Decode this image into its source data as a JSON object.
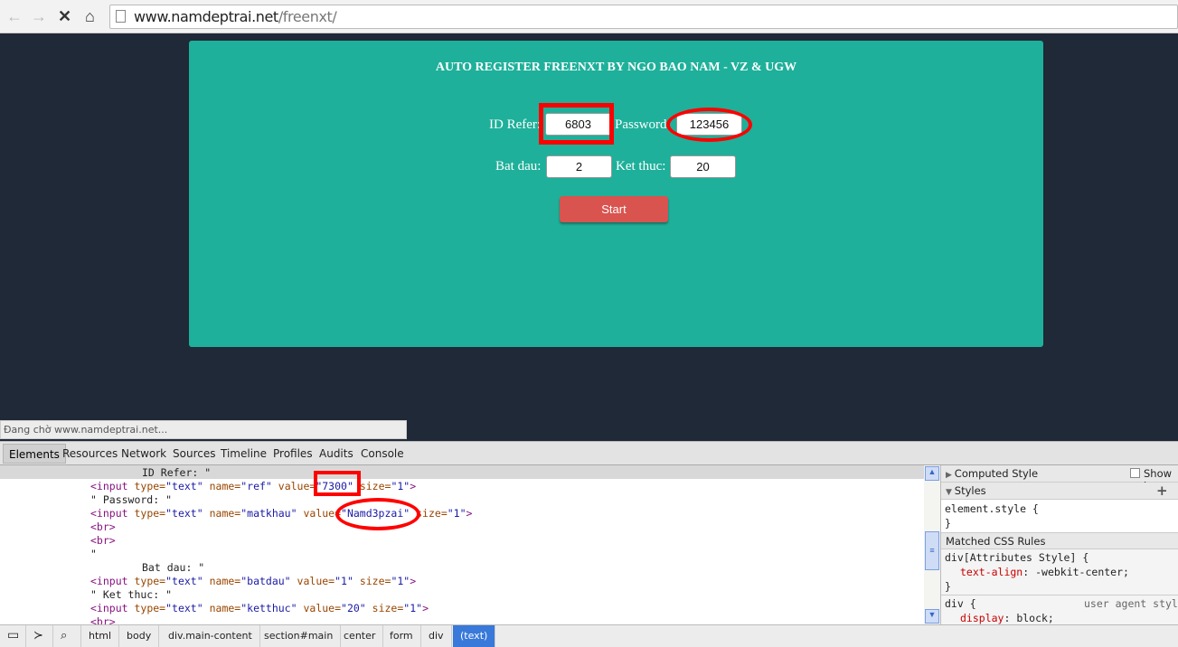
{
  "browser": {
    "url_host": "www.namdeptrai.net",
    "url_path": "/freenxt/",
    "status": "Đang chờ www.namdeptrai.net..."
  },
  "page": {
    "title": "AUTO REGISTER FREENXT BY NGO BAO NAM - VZ & UGW",
    "id_refer_label": "ID Refer:",
    "id_refer_value": "6803",
    "password_label": "Password:",
    "password_value": "123456",
    "bat_dau_label": "Bat dau:",
    "bat_dau_value": "2",
    "ket_thuc_label": "Ket thuc:",
    "ket_thuc_value": "20",
    "start_label": "Start",
    "annotation_color": "#ff0000",
    "panel_color": "#1eb09a"
  },
  "devtools": {
    "tabs": [
      "Elements",
      "Resources",
      "Network",
      "Sources",
      "Timeline",
      "Profiles",
      "Audits",
      "Console"
    ],
    "code": {
      "l0": "ID Refer: \"",
      "input": "<input",
      "type": "type=",
      "text": "\"text\"",
      "name": "name=",
      "value": "value=",
      "size": "size=",
      "one": "\"1\"",
      ">": ">",
      "ref": "\"ref\"",
      "ref_val": "\"7300\"",
      "l2": "\" Password: \"",
      "matkhau": "\"matkhau\"",
      "matkhau_val": "\"Namd3pzai\"",
      "br": "<br>",
      "quote": "\"",
      "l7": "Bat dau: \"",
      "batdau": "\"batdau\"",
      "batdau_val": "\"1\"",
      "l9": "\" Ket thuc: \"",
      "ketthuc": "\"ketthuc\"",
      "ketthuc_val": "\"20\""
    },
    "side": {
      "computed": "Computed Style",
      "show_inherited": "Show in",
      "styles": "Styles",
      "element_style": "element.style {",
      "close": "}",
      "matched": "Matched CSS Rules",
      "rule1_sel": "div[Attributes Style] {",
      "rule1_prop": "text-align",
      "rule1_val": ": -webkit-center;",
      "rule2_sel": "div {",
      "rule2_src": "user agent styl",
      "rule2_prop": "display",
      "rule2_val": ": block;"
    },
    "breadcrumbs": [
      "html",
      "body",
      "div.main-content",
      "section#main",
      "center",
      "form",
      "div",
      "(text)"
    ]
  }
}
